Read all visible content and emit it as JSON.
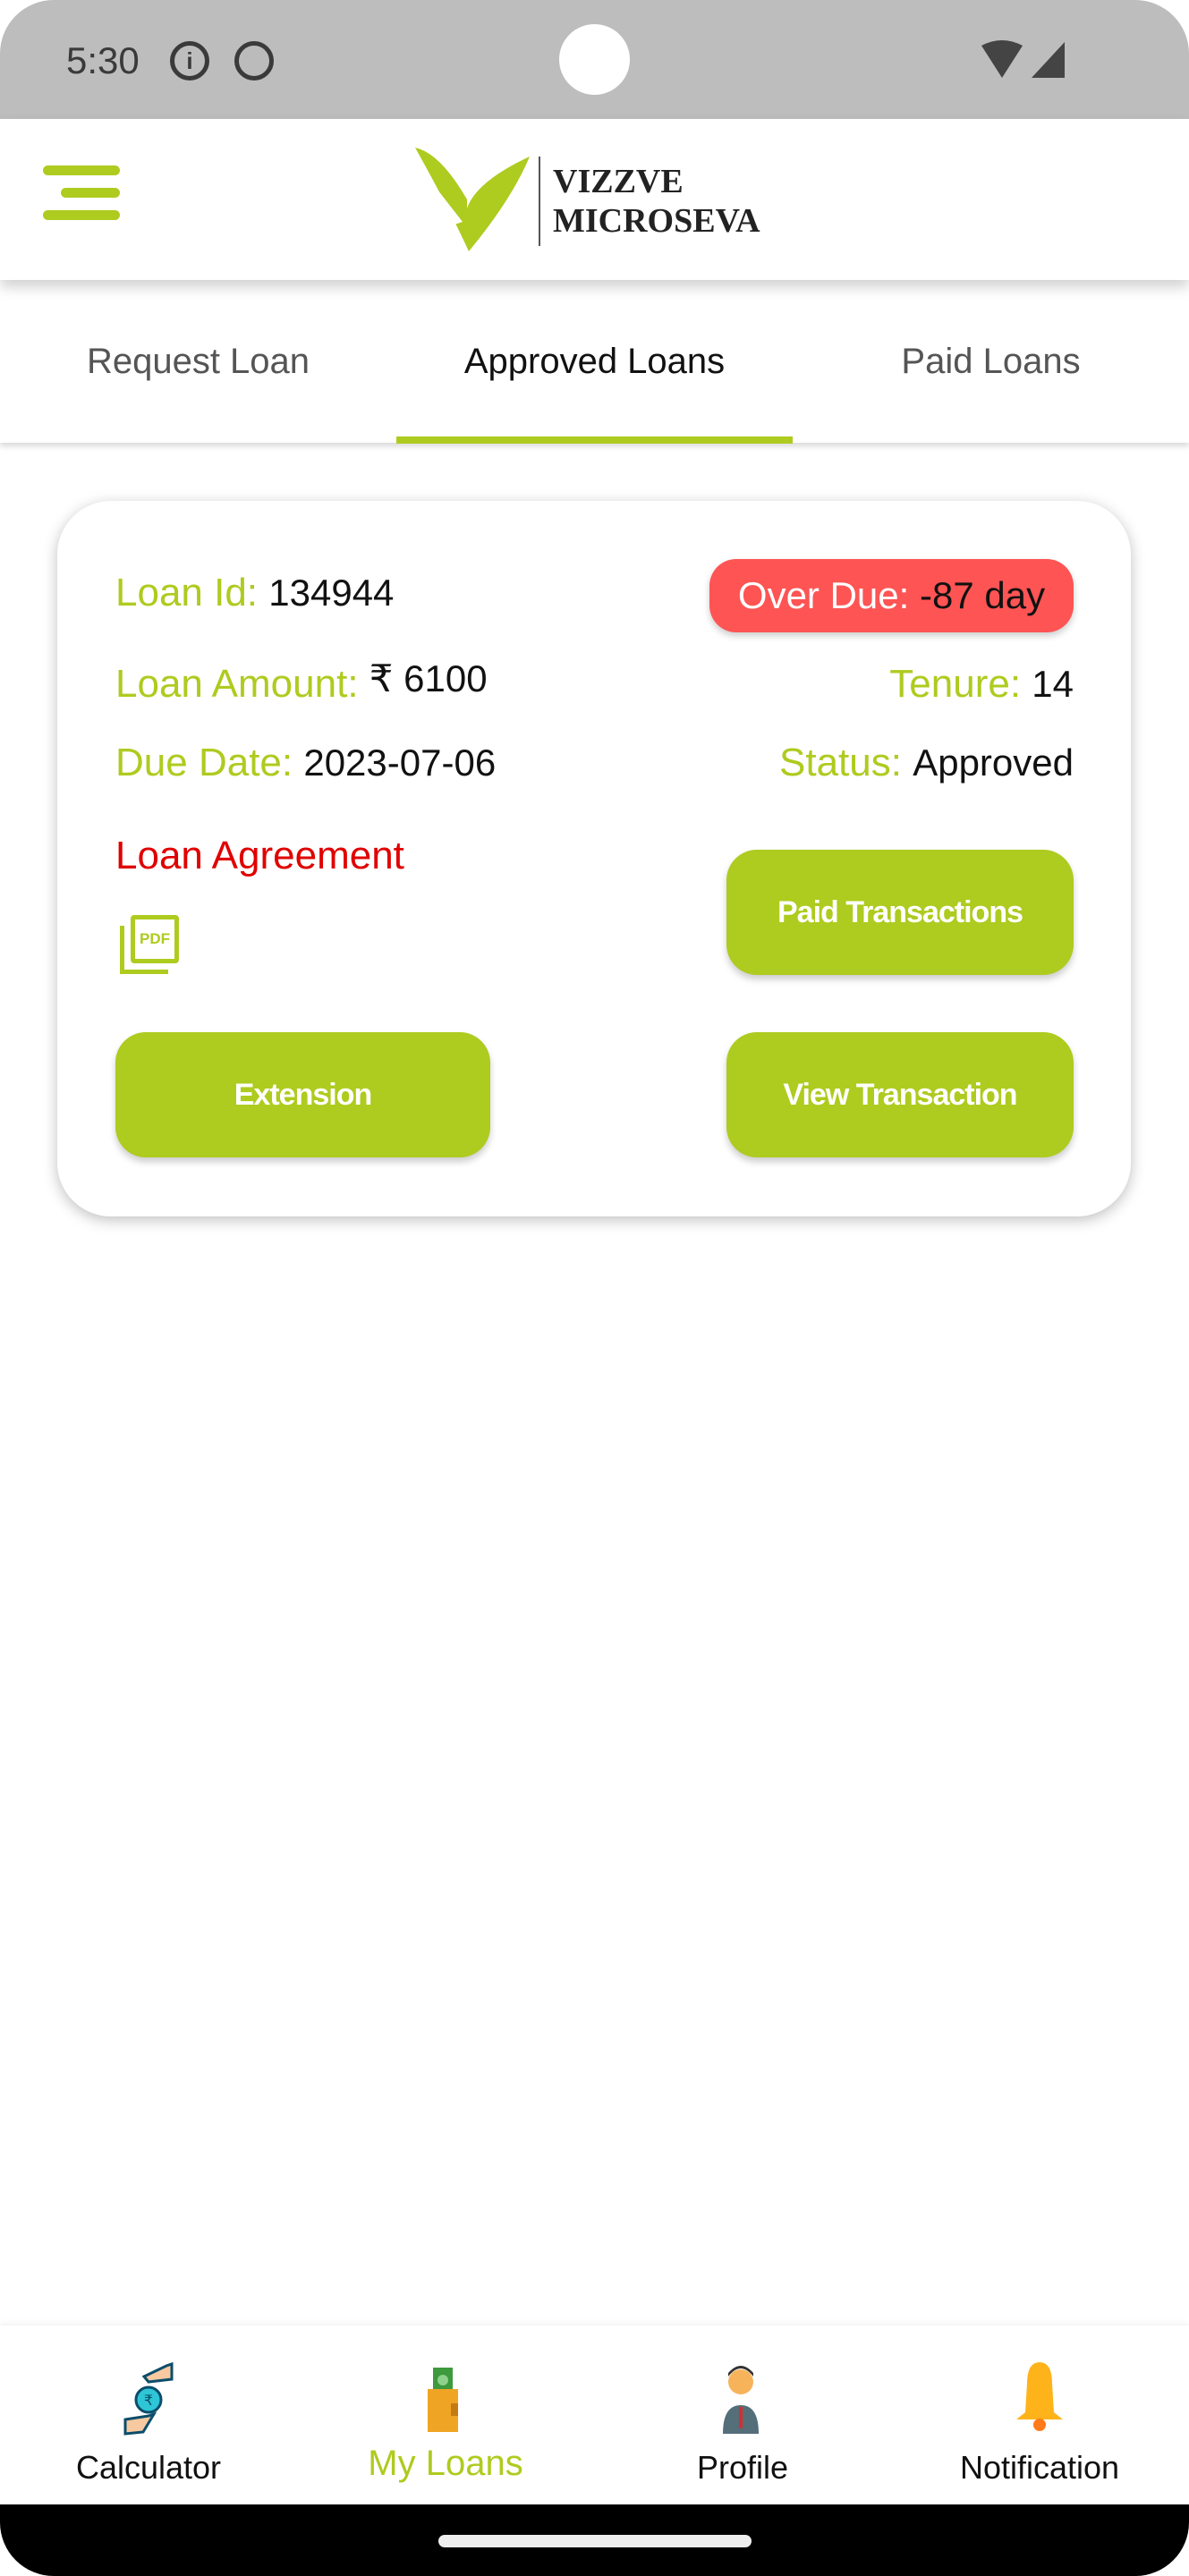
{
  "status_bar": {
    "time": "5:30",
    "icons": [
      "info-icon",
      "face-icon",
      "wifi-icon",
      "signal-icon"
    ]
  },
  "header": {
    "menu_icon": "hamburger-icon",
    "logo_line1": "VIZZVE",
    "logo_line2": "MICROSEVA"
  },
  "tabs": [
    {
      "label": "Request Loan"
    },
    {
      "label": "Approved Loans",
      "active": true
    },
    {
      "label": "Paid Loans"
    }
  ],
  "loan": {
    "loan_id_label": "Loan Id:",
    "loan_id": "134944",
    "overdue_label": "Over Due:",
    "overdue_value": "-87 day",
    "amount_label": "Loan Amount:",
    "amount": "₹ 6100",
    "tenure_label": "Tenure:",
    "tenure": "14",
    "due_date_label": "Due Date:",
    "due_date": "2023-07-06",
    "status_label": "Status:",
    "status": "Approved",
    "agreement_label": "Loan Agreement",
    "pdf_icon_text": "PDF",
    "paid_transactions_label": "Paid Transactions",
    "extension_label": "Extension",
    "view_transaction_label": "View Transaction"
  },
  "bottom_nav": [
    {
      "label": "Calculator",
      "icon": "rupee-exchange-icon"
    },
    {
      "label": "My Loans",
      "icon": "wallet-icon",
      "active": true
    },
    {
      "label": "Profile",
      "icon": "user-icon"
    },
    {
      "label": "Notification",
      "icon": "bell-icon"
    }
  ],
  "colors": {
    "accent": "#aecb1f",
    "overdue": "#fe5454",
    "agreement": "#e00000"
  }
}
